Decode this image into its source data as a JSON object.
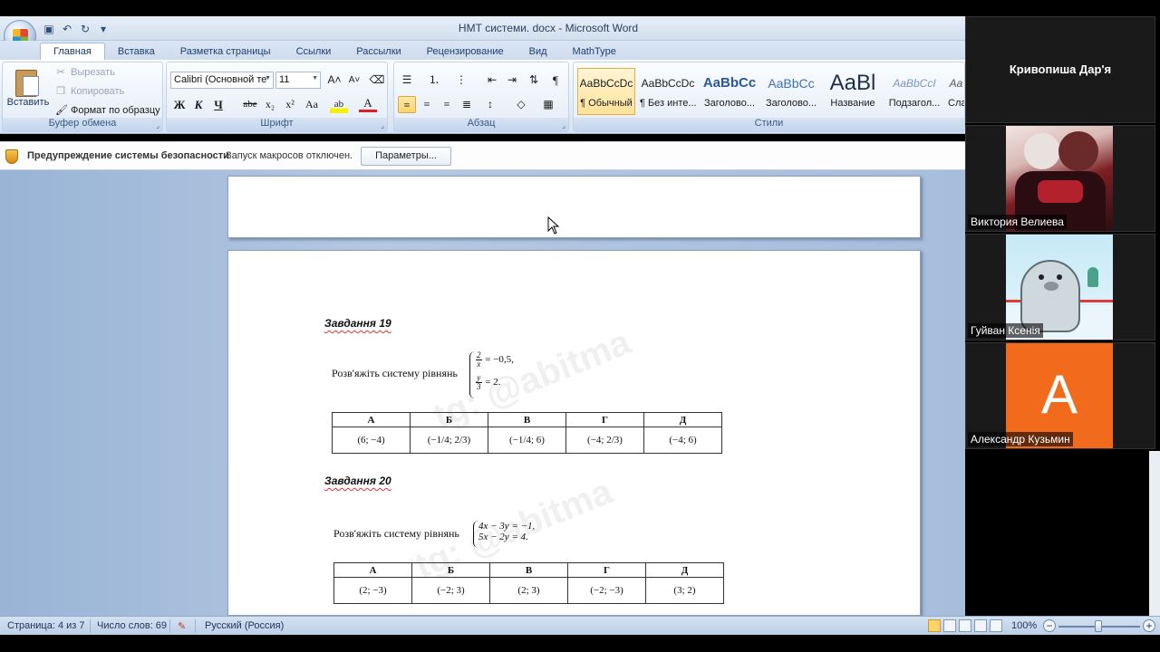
{
  "window": {
    "title": "НМТ системи. docx - Microsoft Word"
  },
  "ribbon": {
    "tabs": [
      "Главная",
      "Вставка",
      "Разметка страницы",
      "Ссылки",
      "Рассылки",
      "Рецензирование",
      "Вид",
      "MathType"
    ],
    "active_tab": "Главная",
    "clipboard": {
      "paste": "Вставить",
      "cut": "Вырезать",
      "copy": "Копировать",
      "format_painter": "Формат по образцу",
      "label": "Буфер обмена"
    },
    "font": {
      "name": "Calibri (Основной те",
      "size": "11",
      "label": "Шрифт"
    },
    "paragraph": {
      "label": "Абзац"
    },
    "styles": {
      "label": "Стили",
      "items": [
        {
          "sample": "AaBbCcDc",
          "name": "¶ Обычный"
        },
        {
          "sample": "AaBbCcDc",
          "name": "¶ Без инте..."
        },
        {
          "sample": "AaBbCc",
          "name": "Заголово..."
        },
        {
          "sample": "AaBbCc",
          "name": "Заголово..."
        },
        {
          "sample": "AaBl",
          "name": "Название"
        },
        {
          "sample": "AaBbCcI",
          "name": "Подзагол..."
        },
        {
          "sample": "Aa",
          "name": "Сла"
        }
      ]
    }
  },
  "security_bar": {
    "title": "Предупреждение системы безопасности",
    "message": "Запуск макросов отключен.",
    "button": "Параметры..."
  },
  "document": {
    "task19": {
      "heading": "Завдання 19",
      "prompt": "Розв'яжіть систему рівнянь",
      "eq1_num": "2",
      "eq1_den": "x",
      "eq1_rhs": "= −0,5,",
      "eq2_num": "y",
      "eq2_den": "3",
      "eq2_rhs": "= 2.",
      "headers": [
        "А",
        "Б",
        "В",
        "Г",
        "Д"
      ],
      "answers": [
        "(6; −4)",
        "(−1/4; 2/3)",
        "(−1/4; 6)",
        "(−4; 2/3)",
        "(−4; 6)"
      ]
    },
    "task20": {
      "heading": "Завдання 20",
      "prompt": "Розв'яжіть систему рівнянь",
      "eq1": "4x − 3y = −1,",
      "eq2": "5x − 2y = 4.",
      "headers": [
        "А",
        "Б",
        "В",
        "Г",
        "Д"
      ],
      "answers": [
        "(2; −3)",
        "(−2; 3)",
        "(2; 3)",
        "(−2; −3)",
        "(3; 2)"
      ]
    },
    "watermark": "tg: @abitma"
  },
  "status_bar": {
    "page": "Страница: 4 из 7",
    "words": "Число слов: 69",
    "language": "Русский (Россия)",
    "zoom": "100%",
    "zoom_level_percent": 100
  },
  "participants": [
    {
      "name": "Кривопиша Дар'я",
      "video": false
    },
    {
      "name": "Виктория Велиева",
      "video": true,
      "avatar": "anime-illustration"
    },
    {
      "name": "Гуйван Ксенія",
      "video": true,
      "avatar": "seal-cartoon"
    },
    {
      "name": "Александр Кузьмин",
      "video": true,
      "avatar_letter": "А",
      "avatar_color": "#f26b1d"
    }
  ]
}
